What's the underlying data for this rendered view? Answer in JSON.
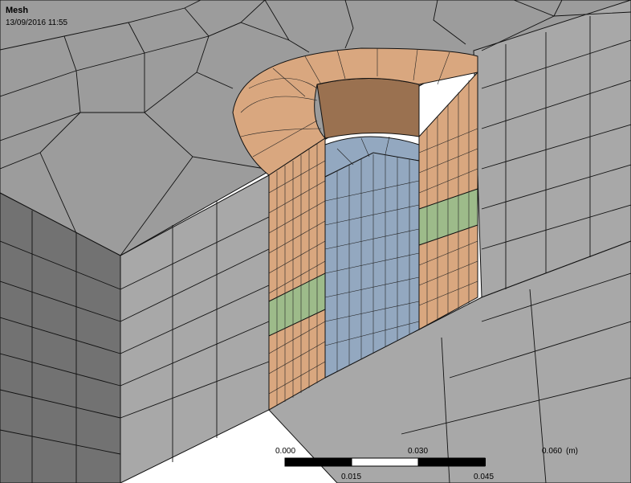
{
  "viewport": {
    "title": "Mesh",
    "timestamp": "13/09/2016 11:55"
  },
  "scale_bar": {
    "top_labels": [
      "0.000",
      "0.030",
      "0.060"
    ],
    "bottom_labels": [
      "0.015",
      "0.045"
    ],
    "unit": "(m)"
  },
  "colors": {
    "block": "#9c9c9c",
    "block_side_dark": "#727272",
    "block_front": "#a8a8a8",
    "ring": "#d9a77f",
    "ring_dark": "#9a7150",
    "core": "#93a8c0",
    "band": "#9dbb8a",
    "mesh_line": "#111111"
  }
}
